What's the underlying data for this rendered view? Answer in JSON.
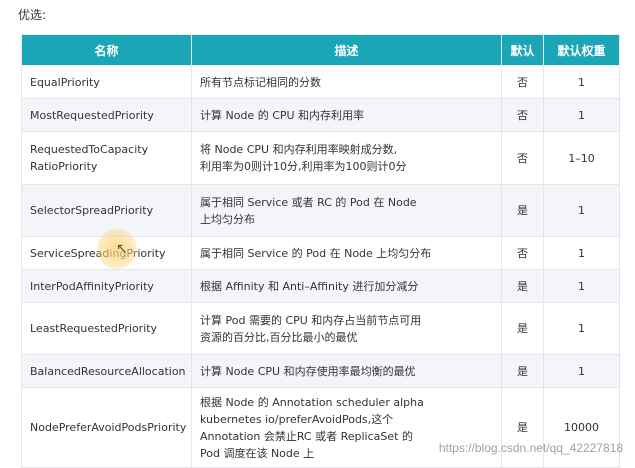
{
  "heading": "优选:",
  "columns": [
    "名称",
    "描述",
    "默认",
    "默认权重"
  ],
  "rows": [
    {
      "name": "EqualPriority",
      "desc": [
        "所有节点标记相同的分数"
      ],
      "def": "否",
      "weight": "1"
    },
    {
      "name": "MostRequestedPriority",
      "desc": [
        "计算 Node 的 CPU 和内存利用率"
      ],
      "def": "否",
      "weight": "1"
    },
    {
      "name": "RequestedToCapacity\nRatioPriority",
      "desc": [
        "将 Node CPU 和内存利用率映射成分数,",
        "利用率为0则计10分,利用率为100则计0分"
      ],
      "def": "否",
      "weight": "1–10"
    },
    {
      "name": "SelectorSpreadPriority",
      "desc": [
        "属于相同 Service 或者 RC 的 Pod 在 Node",
        "上均匀分布"
      ],
      "def": "是",
      "weight": "1"
    },
    {
      "name": "ServiceSpreadingPriority",
      "desc": [
        "属于相同 Service 的 Pod 在 Node 上均匀分布"
      ],
      "def": "否",
      "weight": "1"
    },
    {
      "name": "InterPodAffinityPriority",
      "desc": [
        "根据 Affinity 和 Anti–Affinity 进行加分减分"
      ],
      "def": "是",
      "weight": "1"
    },
    {
      "name": "LeastRequestedPriority",
      "desc": [
        "计算 Pod 需要的 CPU 和内存占当前节点可用",
        "资源的百分比,百分比最小的最优"
      ],
      "def": "是",
      "weight": "1"
    },
    {
      "name": "BalancedResourceAllocation",
      "desc": [
        "计算 Node CPU 和内存使用率最均衡的最优"
      ],
      "def": "是",
      "weight": "1"
    },
    {
      "name": "NodePreferAvoidPodsPriority",
      "desc": [
        "根据 Node 的 Annotation scheduler alpha",
        "kubernetes io/preferAvoidPods,这个",
        "Annotation 会禁止RC 或者 ReplicaSet 的",
        "Pod 调度在该 Node 上"
      ],
      "def": "是",
      "weight": "10000"
    }
  ],
  "watermark": "https://blog.csdn.net/qq_42227818",
  "cursor_icon": "arrow-pointer"
}
